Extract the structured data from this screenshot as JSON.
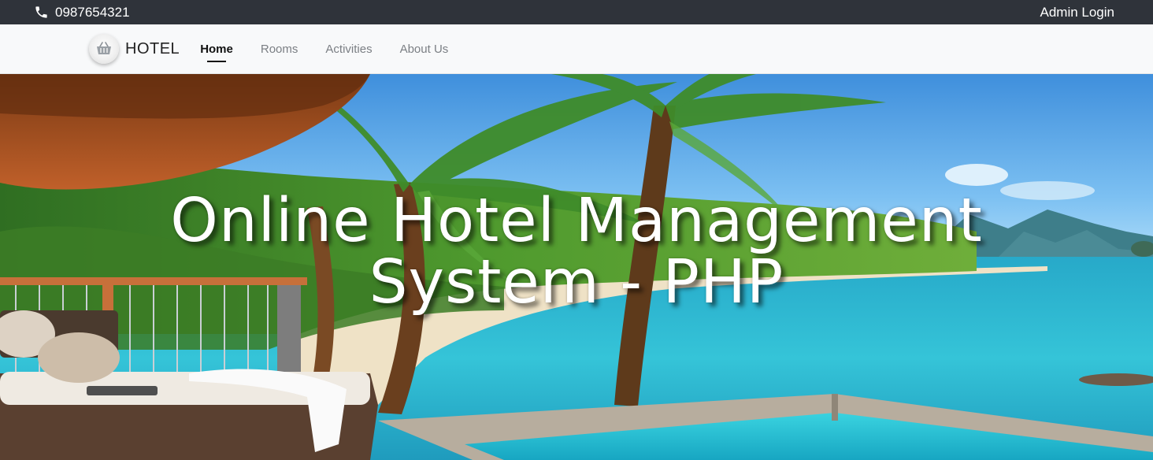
{
  "topbar": {
    "phone_icon": "phone-icon",
    "phone": "0987654321",
    "admin_login": "Admin Login"
  },
  "navbar": {
    "brand_logo_icon": "shopping-basket-icon",
    "brand": "HOTEL",
    "links": [
      {
        "label": "Home",
        "active": true
      },
      {
        "label": "Rooms",
        "active": false
      },
      {
        "label": "Activities",
        "active": false
      },
      {
        "label": "About Us",
        "active": false
      }
    ]
  },
  "hero": {
    "title_line1": "Online Hotel Management",
    "title_line2": "System - PHP",
    "background": "tropical beach resort photo"
  },
  "colors": {
    "topbar_bg": "#2f333a",
    "navbar_bg": "#f8f9fa",
    "text_active": "#111111",
    "text_muted": "#7b7f84"
  }
}
